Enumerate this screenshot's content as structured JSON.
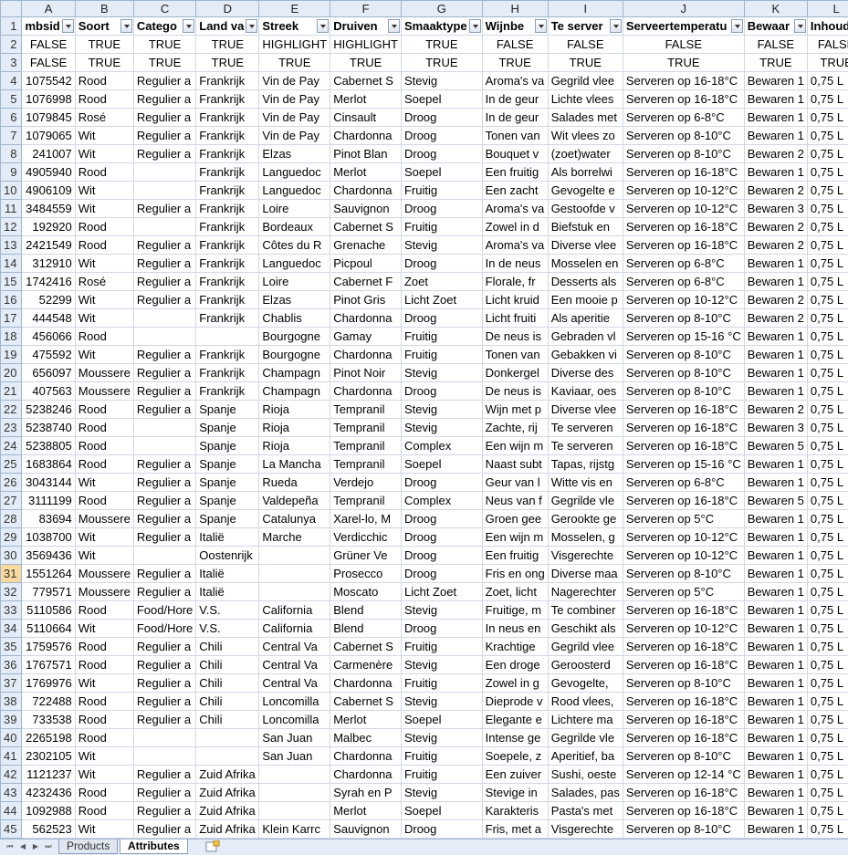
{
  "columns": [
    "A",
    "B",
    "C",
    "D",
    "E",
    "F",
    "G",
    "H",
    "I",
    "J",
    "K",
    "L"
  ],
  "header_row": [
    "mbsid",
    "Soort",
    "Catego",
    "Land va",
    "Streek",
    "Druiven",
    "Smaaktype",
    "Wijnbe",
    "Te server",
    "Serveertemperatu",
    "Bewaar",
    "Inhoud"
  ],
  "row2": [
    "FALSE",
    "TRUE",
    "TRUE",
    "TRUE",
    "HIGHLIGHT",
    "HIGHLIGHT",
    "TRUE",
    "FALSE",
    "FALSE",
    "FALSE",
    "FALSE",
    "FALSE"
  ],
  "row3": [
    "FALSE",
    "TRUE",
    "TRUE",
    "TRUE",
    "TRUE",
    "TRUE",
    "TRUE",
    "TRUE",
    "TRUE",
    "TRUE",
    "TRUE",
    "TRUE"
  ],
  "rows": [
    [
      "1075542",
      "Rood",
      "Regulier a",
      "Frankrijk",
      "Vin de Pay",
      "Cabernet S",
      "Stevig",
      "Aroma's va",
      "Gegrild vlee",
      "Serveren op 16-18°C",
      "Bewaren 1",
      "0,75 L"
    ],
    [
      "1076998",
      "Rood",
      "Regulier a",
      "Frankrijk",
      "Vin de Pay",
      "Merlot",
      "Soepel",
      "In de geur",
      "Lichte vlees",
      "Serveren op 16-18°C",
      "Bewaren 1",
      "0,75 L"
    ],
    [
      "1079845",
      "Rosé",
      "Regulier a",
      "Frankrijk",
      "Vin de Pay",
      "Cinsault",
      "Droog",
      "In de geur",
      "Salades met",
      "Serveren op 6-8°C",
      "Bewaren 1",
      "0,75 L"
    ],
    [
      "1079065",
      "Wit",
      "Regulier a",
      "Frankrijk",
      "Vin de Pay",
      "Chardonna",
      "Droog",
      "Tonen van",
      "Wit vlees zo",
      "Serveren op 8-10°C",
      "Bewaren 1",
      "0,75 L"
    ],
    [
      "241007",
      "Wit",
      "Regulier a",
      "Frankrijk",
      "Elzas",
      "Pinot Blan",
      "Droog",
      "Bouquet v",
      "(zoet)water",
      "Serveren op 8-10°C",
      "Bewaren 2",
      "0,75 L"
    ],
    [
      "4905940",
      "Rood",
      "",
      "Frankrijk",
      "Languedoc",
      "Merlot",
      "Soepel",
      "Een fruitig",
      "Als borrelwi",
      "Serveren op 16-18°C",
      "Bewaren 1",
      "0,75 L"
    ],
    [
      "4906109",
      "Wit",
      "",
      "Frankrijk",
      "Languedoc",
      "Chardonna",
      "Fruitig",
      "Een zacht",
      "Gevogelte e",
      "Serveren op 10-12°C",
      "Bewaren 2",
      "0,75 L"
    ],
    [
      "3484559",
      "Wit",
      "Regulier a",
      "Frankrijk",
      "Loire",
      "Sauvignon",
      "Droog",
      "Aroma's va",
      "Gestoofde v",
      "Serveren op 10-12°C",
      "Bewaren 3",
      "0,75 L"
    ],
    [
      "192920",
      "Rood",
      "",
      "Frankrijk",
      "Bordeaux",
      "Cabernet S",
      "Fruitig",
      "Zowel in d",
      "Biefstuk en",
      "Serveren op 16-18°C",
      "Bewaren 2",
      "0,75 L"
    ],
    [
      "2421549",
      "Rood",
      "Regulier a",
      "Frankrijk",
      "Côtes du R",
      "Grenache",
      "Stevig",
      "Aroma's va",
      "Diverse vlee",
      "Serveren op 16-18°C",
      "Bewaren 2",
      "0,75 L"
    ],
    [
      "312910",
      "Wit",
      "Regulier a",
      "Frankrijk",
      "Languedoc",
      "Picpoul",
      "Droog",
      "In de neus",
      "Mosselen en",
      "Serveren op 6-8°C",
      "Bewaren 1",
      "0,75 L"
    ],
    [
      "1742416",
      "Rosé",
      "Regulier a",
      "Frankrijk",
      "Loire",
      "Cabernet F",
      "Zoet",
      "Florale, fr",
      "Desserts als",
      "Serveren op 6-8°C",
      "Bewaren 1",
      "0,75 L"
    ],
    [
      "52299",
      "Wit",
      "Regulier a",
      "Frankrijk",
      "Elzas",
      "Pinot Gris",
      "Licht Zoet",
      "Licht kruid",
      "Een mooie p",
      "Serveren op 10-12°C",
      "Bewaren 2",
      "0,75 L"
    ],
    [
      "444548",
      "Wit",
      "",
      "Frankrijk",
      "Chablis",
      "Chardonna",
      "Droog",
      "Licht fruiti",
      "Als aperitie",
      "Serveren op 8-10°C",
      "Bewaren 2",
      "0,75 L"
    ],
    [
      "456066",
      "Rood",
      "",
      "",
      "Bourgogne",
      "Gamay",
      "Fruitig",
      "De neus is",
      "Gebraden vl",
      "Serveren op 15-16 °C",
      "Bewaren 1",
      "0,75 L"
    ],
    [
      "475592",
      "Wit",
      "Regulier a",
      "Frankrijk",
      "Bourgogne",
      "Chardonna",
      "Fruitig",
      "Tonen van",
      "Gebakken vi",
      "Serveren op 8-10°C",
      "Bewaren 1",
      "0,75 L"
    ],
    [
      "656097",
      "Moussere",
      "Regulier a",
      "Frankrijk",
      "Champagn",
      "Pinot Noir",
      "Stevig",
      "Donkergel",
      "Diverse des",
      "Serveren op 8-10°C",
      "Bewaren 1",
      "0,75 L"
    ],
    [
      "407563",
      "Moussere",
      "Regulier a",
      "Frankrijk",
      "Champagn",
      "Chardonna",
      "Droog",
      "De neus is",
      "Kaviaar, oes",
      "Serveren op 8-10°C",
      "Bewaren 1",
      "0,75 L"
    ],
    [
      "5238246",
      "Rood",
      "Regulier a",
      "Spanje",
      "Rioja",
      "Tempranil",
      "Stevig",
      "Wijn met p",
      "Diverse vlee",
      "Serveren op 16-18°C",
      "Bewaren 2",
      "0,75 L"
    ],
    [
      "5238740",
      "Rood",
      "",
      "Spanje",
      "Rioja",
      "Tempranil",
      "Stevig",
      "Zachte, rij",
      "Te serveren",
      "Serveren op 16-18°C",
      "Bewaren 3",
      "0,75 L"
    ],
    [
      "5238805",
      "Rood",
      "",
      "Spanje",
      "Rioja",
      "Tempranil",
      "Complex",
      "Een wijn m",
      "Te serveren",
      "Serveren op 16-18°C",
      "Bewaren 5",
      "0,75 L"
    ],
    [
      "1683864",
      "Rood",
      "Regulier a",
      "Spanje",
      "La Mancha",
      "Tempranil",
      "Soepel",
      "Naast subt",
      "Tapas, rijstg",
      "Serveren op 15-16 °C",
      "Bewaren 1",
      "0,75 L"
    ],
    [
      "3043144",
      "Wit",
      "Regulier a",
      "Spanje",
      "Rueda",
      "Verdejo",
      "Droog",
      "Geur van l",
      "Witte vis en",
      "Serveren op 6-8°C",
      "Bewaren 1",
      "0,75 L"
    ],
    [
      "3111199",
      "Rood",
      "Regulier a",
      "Spanje",
      "Valdepeña",
      "Tempranil",
      "Complex",
      "Neus van f",
      "Gegrilde vle",
      "Serveren op 16-18°C",
      "Bewaren 5",
      "0,75 L"
    ],
    [
      "83694",
      "Moussere",
      "Regulier a",
      "Spanje",
      "Catalunya",
      "Xarel-lo, M",
      "Droog",
      "Groen gee",
      "Gerookte ge",
      "Serveren op 5°C",
      "Bewaren 1",
      "0,75 L"
    ],
    [
      "1038700",
      "Wit",
      "Regulier a",
      "Italië",
      "Marche",
      "Verdicchic",
      "Droog",
      "Een wijn m",
      "Mosselen, g",
      "Serveren op 10-12°C",
      "Bewaren 1",
      "0,75 L"
    ],
    [
      "3569436",
      "Wit",
      "",
      "Oostenrijk",
      "",
      "Grüner Ve",
      "Droog",
      "Een fruitig",
      "Visgerechte",
      "Serveren op 10-12°C",
      "Bewaren 1",
      "0,75 L"
    ],
    [
      "1551264",
      "Moussere",
      "Regulier a",
      "Italië",
      "",
      "Prosecco",
      "Droog",
      "Fris en ong",
      "Diverse maa",
      "Serveren op 8-10°C",
      "Bewaren 1",
      "0,75 L"
    ],
    [
      "779571",
      "Moussere",
      "Regulier a",
      "Italië",
      "",
      "Moscato",
      "Licht Zoet",
      "Zoet, licht",
      "Nagerechter",
      "Serveren op 5°C",
      "Bewaren 1",
      "0,75 L"
    ],
    [
      "5110586",
      "Rood",
      "Food/Hore",
      "V.S.",
      "California",
      "Blend",
      "Stevig",
      "Fruitige, m",
      "Te combiner",
      "Serveren op 16-18°C",
      "Bewaren 1",
      "0,75 L"
    ],
    [
      "5110664",
      "Wit",
      "Food/Hore",
      "V.S.",
      "California",
      "Blend",
      "Droog",
      "In neus en",
      "Geschikt als",
      "Serveren op 10-12°C",
      "Bewaren 1",
      "0,75 L"
    ],
    [
      "1759576",
      "Rood",
      "Regulier a",
      "Chili",
      "Central Va",
      "Cabernet S",
      "Fruitig",
      "Krachtige",
      "Gegrild vlee",
      "Serveren op 16-18°C",
      "Bewaren 1",
      "0,75 L"
    ],
    [
      "1767571",
      "Rood",
      "Regulier a",
      "Chili",
      "Central Va",
      "Carmenère",
      "Stevig",
      "Een droge",
      "Geroosterd",
      "Serveren op 16-18°C",
      "Bewaren 1",
      "0,75 L"
    ],
    [
      "1769976",
      "Wit",
      "Regulier a",
      "Chili",
      "Central Va",
      "Chardonna",
      "Fruitig",
      "Zowel in g",
      "Gevogelte,",
      "Serveren op 8-10°C",
      "Bewaren 1",
      "0,75 L"
    ],
    [
      "722488",
      "Rood",
      "Regulier a",
      "Chili",
      "Loncomilla",
      "Cabernet S",
      "Stevig",
      "Dieprode v",
      "Rood vlees,",
      "Serveren op 16-18°C",
      "Bewaren 1",
      "0,75 L"
    ],
    [
      "733538",
      "Rood",
      "Regulier a",
      "Chili",
      "Loncomilla",
      "Merlot",
      "Soepel",
      "Elegante e",
      "Lichtere ma",
      "Serveren op 16-18°C",
      "Bewaren 1",
      "0,75 L"
    ],
    [
      "2265198",
      "Rood",
      "",
      "",
      "San Juan",
      "Malbec",
      "Stevig",
      "Intense ge",
      "Gegrilde vle",
      "Serveren op 16-18°C",
      "Bewaren 1",
      "0,75 L"
    ],
    [
      "2302105",
      "Wit",
      "",
      "",
      "San Juan",
      "Chardonna",
      "Fruitig",
      "Soepele, z",
      "Aperitief, ba",
      "Serveren op 8-10°C",
      "Bewaren 1",
      "0,75 L"
    ],
    [
      "1121237",
      "Wit",
      "Regulier a",
      "Zuid Afrika",
      "",
      "Chardonna",
      "Fruitig",
      "Een zuiver",
      "Sushi, oeste",
      "Serveren op 12-14 °C",
      "Bewaren 1",
      "0,75 L"
    ],
    [
      "4232436",
      "Rood",
      "Regulier a",
      "Zuid Afrika",
      "",
      "Syrah en P",
      "Stevig",
      "Stevige in",
      "Salades, pas",
      "Serveren op 16-18°C",
      "Bewaren 1",
      "0,75 L"
    ],
    [
      "1092988",
      "Rood",
      "Regulier a",
      "Zuid Afrika",
      "",
      "Merlot",
      "Soepel",
      "Karakteris",
      "Pasta's met",
      "Serveren op 16-18°C",
      "Bewaren 1",
      "0,75 L"
    ],
    [
      "562523",
      "Wit",
      "Regulier a",
      "Zuid Afrika",
      "Klein Karrc",
      "Sauvignon",
      "Droog",
      "Fris, met a",
      "Visgerechte",
      "Serveren op 8-10°C",
      "Bewaren 1",
      "0,75 L"
    ]
  ],
  "selected_row": "31",
  "sheet_tabs": [
    "Products",
    "Attributes"
  ],
  "active_tab": "Attributes",
  "colors": {
    "header_bg": "#e4ecf7",
    "grid": "#d0d7e5",
    "selected_row_header": "#f9d99f"
  }
}
